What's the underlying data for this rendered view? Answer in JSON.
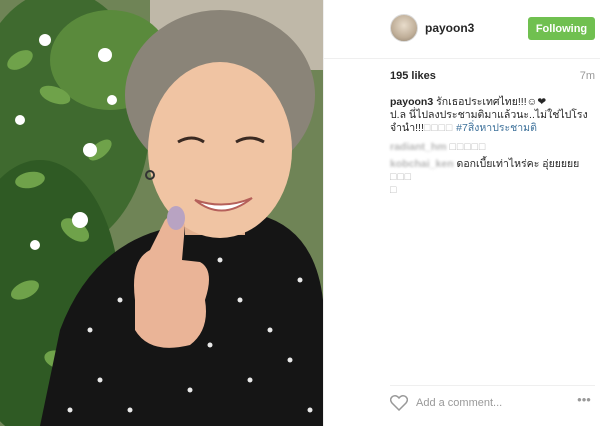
{
  "post": {
    "username": "payoon3",
    "follow_label": "Following",
    "likes": "195 likes",
    "time_ago": "7m",
    "caption": {
      "author": "payoon3",
      "line1": "รักเธอประเทศไทย!!!☺❤",
      "line2": "ป.ล นี่ไปลงประชามติมาแล้วนะ..ไม่ใช่ไปโรง",
      "line3_text": "จำนำ!!!",
      "line3_boxes": "□□□□",
      "hashtag": "#7สิ่งหาประชามติ"
    },
    "comments": [
      {
        "author": "radiant_hm",
        "text": "□□□□□"
      },
      {
        "author": "kobchai_ken",
        "text": "ดอกเบี้ยเท่าไหร่คะ อุ่ยยยยย",
        "trailing_boxes": "□□□",
        "trailing_box2": "□"
      }
    ],
    "add_comment_placeholder": "Add a comment...",
    "more_label": "•••"
  },
  "colors": {
    "follow_button": "#70c050",
    "hashtag": "#3f729b",
    "muted": "#999999"
  },
  "icons": {
    "like": "heart-outline-icon",
    "more": "ellipsis-icon"
  }
}
